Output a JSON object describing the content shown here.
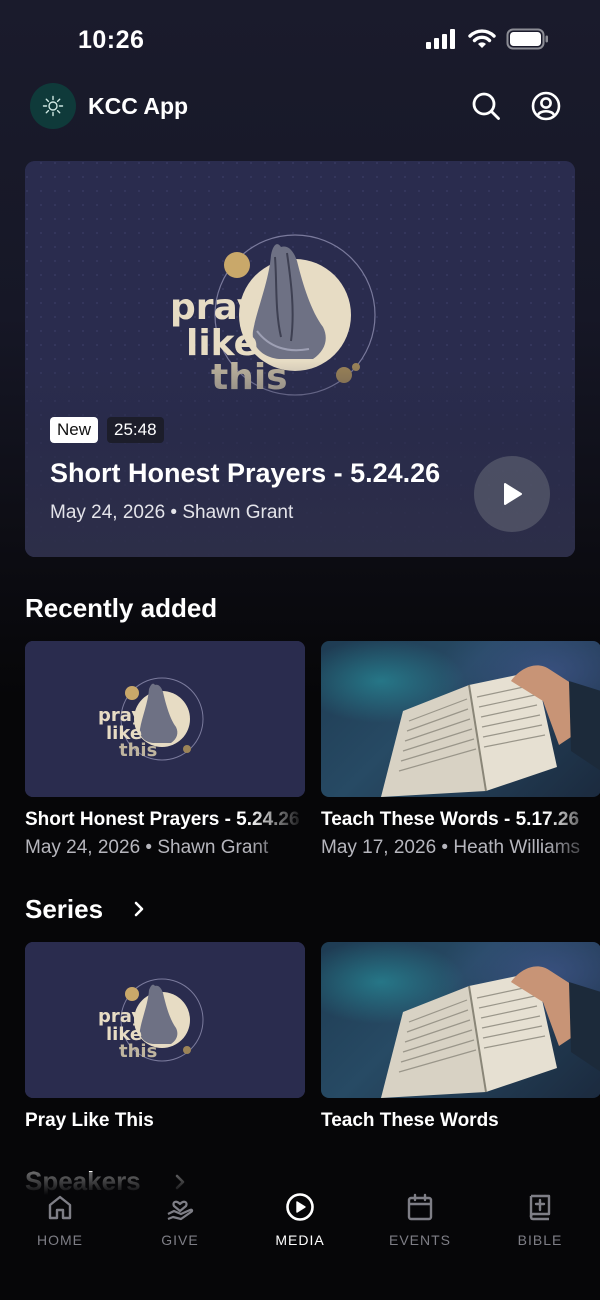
{
  "status_bar": {
    "time": "10:26"
  },
  "header": {
    "app_name": "KCC App"
  },
  "featured": {
    "badge": "New",
    "duration": "25:48",
    "title": "Short Honest Prayers - 5.24.26",
    "meta": "May 24, 2026 • Shawn Grant",
    "artwork_text": [
      "pray",
      "like",
      "this"
    ]
  },
  "recently_added": {
    "title": "Recently added",
    "items": [
      {
        "title": "Short Honest Prayers - 5.24.26",
        "meta": "May 24, 2026 • Shawn Grant",
        "thumb": "pray-like-this"
      },
      {
        "title": "Teach These Words - 5.17.26",
        "meta": "May 17, 2026 • Heath Williams",
        "thumb": "open-bible"
      }
    ]
  },
  "series": {
    "title": "Series",
    "items": [
      {
        "title": "Pray Like This",
        "thumb": "pray-like-this"
      },
      {
        "title": "Teach These Words",
        "thumb": "open-bible"
      }
    ]
  },
  "speakers": {
    "title": "Speakers"
  },
  "nav": {
    "items": [
      {
        "label": "HOME",
        "icon": "home-icon",
        "active": false
      },
      {
        "label": "GIVE",
        "icon": "give-icon",
        "active": false
      },
      {
        "label": "MEDIA",
        "icon": "media-icon",
        "active": true
      },
      {
        "label": "EVENTS",
        "icon": "calendar-icon",
        "active": false
      },
      {
        "label": "BIBLE",
        "icon": "bible-icon",
        "active": false
      }
    ]
  },
  "colors": {
    "background": "#060608",
    "hero": "#2a2c4e",
    "accent_gold": "#c9a86a",
    "muted": "#7e7e86"
  }
}
